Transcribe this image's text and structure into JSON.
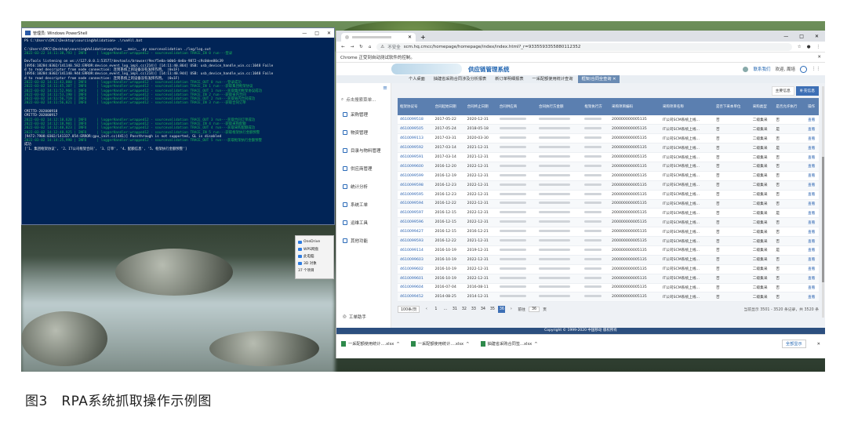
{
  "powershell": {
    "title": "管理员: Windows PowerShell",
    "controls": [
      "—",
      "□",
      "✕"
    ],
    "lines": [
      {
        "t": "PS C:\\Users\\CMCC\\Desktop\\sourcingValidation> .\\runAll.bat",
        "c": ""
      },
      {
        "t": "",
        "c": ""
      },
      {
        "t": "C:\\Users\\CMCC\\Desktop\\sourcingValidation>python __main__.py sourcevalidation ./log/log.out",
        "c": ""
      },
      {
        "t": "2022-03-22 14:11:38,793 | INFO     | loggerHandler:wrapped12 - sourcevalidation TRACE_IN 0 run---登录",
        "c": "g"
      },
      {
        "t": "",
        "c": ""
      },
      {
        "t": "DevTools listening on ws://127.0.0.1:53577/devtools/browser/9ecf5e0a-b0b6-4e0a-9872-c9c0dee80c39",
        "c": ""
      },
      {
        "t": "[4956:18284:0302/141140.582:ERROR:device_event_log_impl.cc(214)] [14:11:40.864] USB: usb_device_handle_win.cc:1048 Faile",
        "c": ""
      },
      {
        "t": "d to read descriptor from node connection: 连到系统上的设备没有发挥作用。 (0x1F)",
        "c": ""
      },
      {
        "t": "[4956:18284:0302/141140.944:ERROR:device_event_log_impl.cc(214)] [14:11:40.944] USB: usb_device_handle_win.cc:1048 Faile",
        "c": ""
      },
      {
        "t": "d to read descriptor from node connection: 连到系统上的设备没有发挥作用。 (0x1F)",
        "c": ""
      },
      {
        "t": "2022-03-02 14:11:43,000 | INFO     | loggerHandler:wrapped12 - sourcevalidation TRACE_OUT 0 run---登录成功",
        "c": "g"
      },
      {
        "t": "2022-03-02 14:11:45,307 | INFO     | loggerHandler:wrapped12 - sourcevalidation TRACE_IN 1 run---获取集团框架协议",
        "c": "g"
      },
      {
        "t": "2022-03-02 14:11:52,966 | INFO     | loggerHandler:wrapped12 - sourcevalidation TRACE_OUT 1 run---获取集团框架协议成功",
        "c": "g"
      },
      {
        "t": "2022-03-02 14:11:53,190 | INFO     | loggerHandler:wrapped12 - sourcevalidation TRACE_IN 2 run---获取省内合同",
        "c": "g"
      },
      {
        "t": "2022-03-02 14:11:56,719 | INFO     | loggerHandler:wrapped12 - sourcevalidation TRACE_OUT 2 run---获取省内合同成功",
        "c": "g"
      },
      {
        "t": "2022-03-02 14:11:56,821 | INFO     | loggerHandler:wrapped12 - sourcevalidation TRACE_IN 3 run---获取合同订单",
        "c": "g"
      },
      {
        "t": "",
        "c": ""
      },
      {
        "t": "CMITTD-202000918",
        "c": ""
      },
      {
        "t": "CMITTD-202000917",
        "c": ""
      },
      {
        "t": "2022-03-02 14:12:18,620 | INFO     | loggerHandler:wrapped12 - sourcevalidation TRACE_OUT 3 run---获取合同订单成功",
        "c": "g"
      },
      {
        "t": "2022-03-02 14:12:18,901 | INFO     | loggerHandler:wrapped12 - sourcevalidation TRACE_IN 4 run---获取采购配额",
        "c": "g"
      },
      {
        "t": "2022-03-02 14:12:48,823 | INFO     | loggerHandler:wrapped12 - sourcevalidation TRACE_OUT 4 run---获取采购配额成功",
        "c": "g"
      },
      {
        "t": "2022-03-02 14:12:48,925 | INFO     | loggerHandler:wrapped12 - sourcevalidation TRACE_IN 5 run---获取框架执行金额预警",
        "c": "g"
      },
      {
        "t": "[9472:7908:0302/141337.054:ERROR:gpu_init.cc(441)] Passthrough is not supported, GL is disabled",
        "c": ""
      },
      {
        "t": "2022-03-02 14:14:25,990 | INFO     | loggerHandler:wrapped12 - sourcevalidation TRACE_OUT 5 run---获取框架执行金额预警",
        "c": "g"
      },
      {
        "t": "成功",
        "c": ""
      },
      {
        "t": "['1、集团框架协议', '2、IT公司框架合同', '3、订单', '4、配额信息', '5、框架执行金额预警']",
        "c": ""
      }
    ]
  },
  "onedrive_popup": [
    "OneDrive",
    "WPS网盘",
    "此电脑",
    "3D 对象",
    "37 个项目"
  ],
  "browser": {
    "controls": [
      "—",
      "□",
      "✕"
    ],
    "url": "scm.hq.cmcc/homepage/homepage/index/index.html?_r=9335593355880112352",
    "not_secure": "不安全",
    "infobar": "Chrome 正受到自动测试软件的控制。",
    "app_name": "供应链管理系统",
    "header_links": [
      "联系我们",
      "欢迎, 周培"
    ],
    "nav_tabs": [
      "个人桌面",
      "抽建省采购合同涉及分析报表",
      "新订单明细报表",
      "一采配额使用统计查询",
      "框架/合同全查询 ✕"
    ],
    "sidebar": {
      "search": "点击搜索菜单...",
      "items": [
        "采购管理",
        "物资管理",
        "目录与物料管理",
        "供应商管理",
        "统计分析",
        "系统工单",
        "运维工具",
        "其他功能"
      ],
      "helper": "工单助手"
    },
    "top_buttons": [
      "主要信息",
      "补充信息"
    ],
    "columns": [
      "框架协议号",
      "合同起始日期",
      "合同终止日期",
      "合同供应商",
      "合同执行方金额",
      "框架执行方",
      "采购项目编码",
      "采购项目名称",
      "是否下采本单位",
      "采购类型",
      "是否允许执行",
      "操作"
    ],
    "rows": [
      [
        "4610099518",
        "2017-05-22",
        "2020-12-31",
        "200000000005135",
        "IT公司SCM系统上线...",
        "否",
        "二级集采",
        "否",
        "查看"
      ],
      [
        "4610099505",
        "2017-05-24",
        "2018-05-18",
        "200000000005135",
        "IT公司SCM系统上线...",
        "否",
        "二级集采",
        "是",
        "查看"
      ],
      [
        "4610099113",
        "2017-03-31",
        "2020-03-30",
        "200000000005135",
        "IT公司SCM系统上线...",
        "否",
        "二级集采",
        "否",
        "查看"
      ],
      [
        "4610099592",
        "2017-03-14",
        "2021-12-31",
        "200000000005135",
        "IT公司SCM系统上线...",
        "否",
        "二级集采",
        "是",
        "查看"
      ],
      [
        "4610099591",
        "2017-03-14",
        "2021-12-31",
        "200000000005135",
        "IT公司SCM系统上线...",
        "否",
        "二级集采",
        "否",
        "查看"
      ],
      [
        "4610099600",
        "2016-12-20",
        "2022-12-31",
        "200000000005135",
        "IT公司SCM系统上线...",
        "否",
        "二级集采",
        "否",
        "查看"
      ],
      [
        "4610099599",
        "2016-12-19",
        "2022-12-31",
        "200000000005135",
        "IT公司SCM系统上线...",
        "否",
        "二级集采",
        "否",
        "查看"
      ],
      [
        "4610099598",
        "2016-12-23",
        "2022-12-31",
        "200000000005135",
        "IT公司SCM系统上线...",
        "否",
        "二级集采",
        "否",
        "查看"
      ],
      [
        "4610099595",
        "2016-12-23",
        "2022-12-31",
        "200000000005135",
        "IT公司SCM系统上线...",
        "否",
        "二级集采",
        "否",
        "查看"
      ],
      [
        "4610099594",
        "2016-12-22",
        "2022-12-31",
        "200000000005135",
        "IT公司SCM系统上线...",
        "否",
        "二级集采",
        "否",
        "查看"
      ],
      [
        "4610099597",
        "2016-12-15",
        "2022-12-31",
        "200000000005135",
        "IT公司SCM系统上线...",
        "否",
        "二级集采",
        "是",
        "查看"
      ],
      [
        "4610099596",
        "2016-12-15",
        "2022-12-31",
        "200000000005135",
        "IT公司SCM系统上线...",
        "否",
        "二级集采",
        "否",
        "查看"
      ],
      [
        "4610099427",
        "2016-12-15",
        "2016-12-21",
        "200000000005135",
        "IT公司SCM系统上线...",
        "否",
        "二级集采",
        "否",
        "查看"
      ],
      [
        "4610099593",
        "2016-12-22",
        "2021-12-31",
        "200000000005135",
        "IT公司SCM系统上线...",
        "否",
        "二级集采",
        "否",
        "查看"
      ],
      [
        "4610099114",
        "2016-10-19",
        "2019-12-31",
        "200000000005135",
        "IT公司SCM系统上线...",
        "否",
        "二级集采",
        "是",
        "查看"
      ],
      [
        "4610099603",
        "2016-10-19",
        "2022-12-31",
        "200000000005135",
        "IT公司SCM系统上线...",
        "否",
        "二级集采",
        "否",
        "查看"
      ],
      [
        "4610099602",
        "2016-10-19",
        "2022-12-31",
        "200000000005135",
        "IT公司SCM系统上线...",
        "否",
        "二级集采",
        "否",
        "查看"
      ],
      [
        "4610099601",
        "2016-10-19",
        "2022-12-31",
        "200000000005135",
        "IT公司SCM系统上线...",
        "否",
        "二级集采",
        "否",
        "查看"
      ],
      [
        "4610099604",
        "2016-07-04",
        "2016-08-11",
        "200000000005135",
        "IT公司SCM系统上线...",
        "否",
        "二级集采",
        "否",
        "查看"
      ],
      [
        "4610099452",
        "2014-08-25",
        "2014-12-31",
        "200000000005135",
        "IT公司SCM系统上线...",
        "否",
        "二级集采",
        "否",
        "查看"
      ]
    ],
    "pager": {
      "page_size": "100条/页",
      "pages": [
        "‹",
        "1",
        "...",
        "31",
        "32",
        "33",
        "34",
        "35",
        "36",
        "›"
      ],
      "current": "36",
      "goto_prefix": "前往",
      "goto_value": "36",
      "goto_suffix": "页",
      "info": "当前显示 3501 - 3520 条记录，共 3520 条"
    },
    "copyright": "Copyright © 1999-2020 中国移动 版权所有",
    "downloads": [
      "一采配额使用统计....xlsx",
      "一采配额使用统计....xlsx",
      "抽建省采购合同签...xlsx"
    ],
    "downloads_all": "全部显示"
  },
  "caption": "图3　RPA系统抓取操作示例图"
}
